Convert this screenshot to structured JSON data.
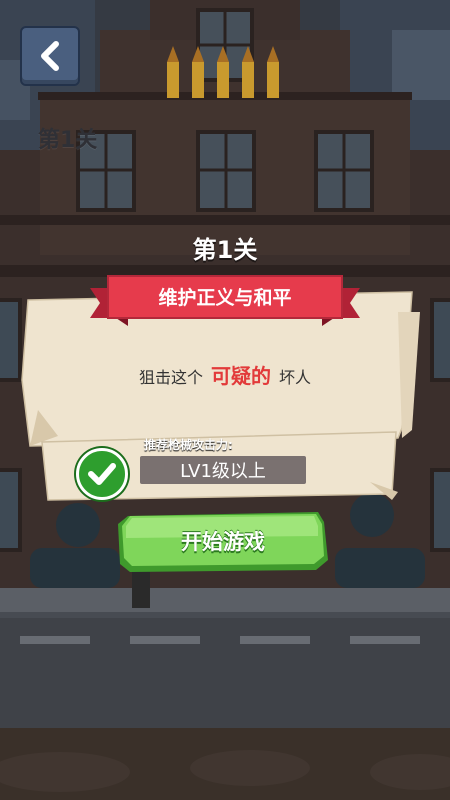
{
  "header": {
    "back_icon": "chevron-left-icon",
    "level_small": "第1关"
  },
  "level": {
    "title": "第1关"
  },
  "mission": {
    "banner": "维护正义与和平",
    "prefix": "狙击这个",
    "highlight": "可疑的",
    "suffix": "坏人"
  },
  "requirement": {
    "label": "推荐枪械攻击力:",
    "value": "LV1级以上",
    "status_icon": "checkmark-icon"
  },
  "start_button": {
    "label": "开始游戏"
  },
  "colors": {
    "ribbon": "#e63b4c",
    "highlight": "#e23a3a",
    "start_green": "#7fd65a",
    "check_green": "#2e9e2e"
  }
}
